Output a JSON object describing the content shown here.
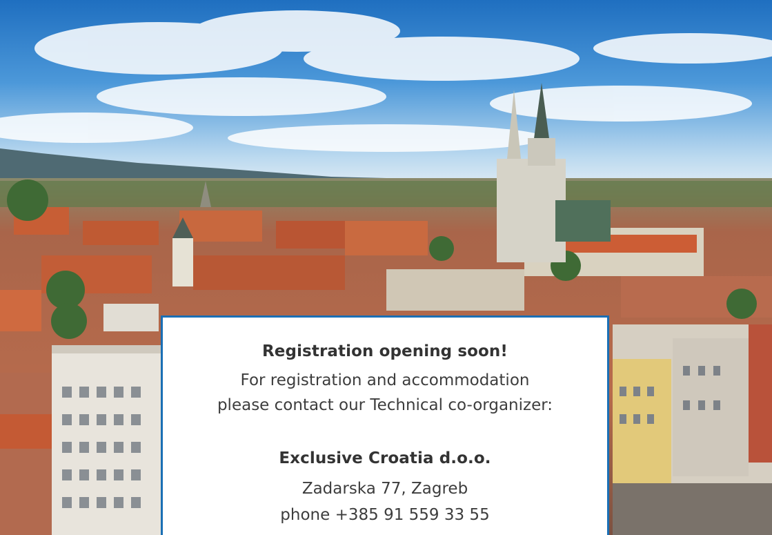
{
  "background": {
    "description_icon": "city-panorama-photo",
    "sky_color": "#3d8dd2",
    "roof_color": "#c4623c"
  },
  "card": {
    "border_color": "#1a6fb5",
    "heading": "Registration opening soon!",
    "line1": "For registration and accommodation",
    "line2": "please contact our Technical co-organizer:",
    "company": "Exclusive Croatia d.o.o.",
    "address": "Zadarska 77, Zagreb",
    "phone": "phone +385 91 559 33 55"
  }
}
